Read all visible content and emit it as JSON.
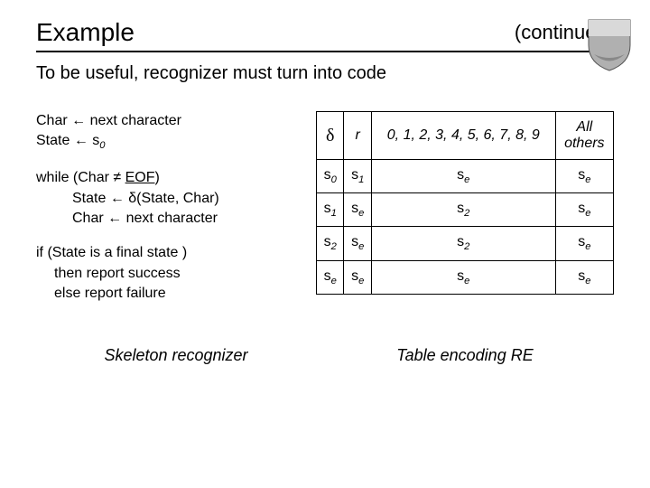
{
  "header": {
    "title": "Example",
    "continued": "(continued)"
  },
  "subtitle": "To be useful, recognizer must turn into code",
  "pseudocode": {
    "l1a": "Char ",
    "l1b": " next character",
    "l2a": "State ",
    "l2b": " s",
    "l2sub": "0",
    "l3a": "while (Char ",
    "l3b": " ",
    "l3c": "EOF",
    "l3d": ")",
    "l4a": "State ",
    "l4b": " ",
    "l4c": "(State, Char)",
    "l5a": "Char ",
    "l5b": " next character",
    "l6": "if (State is a final state )",
    "l7": "then report success",
    "l8": "else  report failure",
    "arrow": "←",
    "neq": "≠",
    "delta": "δ"
  },
  "table": {
    "h1": "δ",
    "h2": "r",
    "h3": "0, 1, 2, 3, 4, 5, 6, 7, 8, 9",
    "h4_a": "All",
    "h4_b": "others",
    "rows": [
      {
        "c0": "s",
        "c0s": "0",
        "c1": "s",
        "c1s": "1",
        "c2": "s",
        "c2s": "e",
        "c3": "s",
        "c3s": "e"
      },
      {
        "c0": "s",
        "c0s": "1",
        "c1": "s",
        "c1s": "e",
        "c2": "s",
        "c2s": "2",
        "c3": "s",
        "c3s": "e"
      },
      {
        "c0": "s",
        "c0s": "2",
        "c1": "s",
        "c1s": "e",
        "c2": "s",
        "c2s": "2",
        "c3": "s",
        "c3s": "e"
      },
      {
        "c0": "s",
        "c0s": "e",
        "c1": "s",
        "c1s": "e",
        "c2": "s",
        "c2s": "e",
        "c3": "s",
        "c3s": "e"
      }
    ]
  },
  "captions": {
    "left": "Skeleton recognizer",
    "right": "Table encoding RE"
  }
}
